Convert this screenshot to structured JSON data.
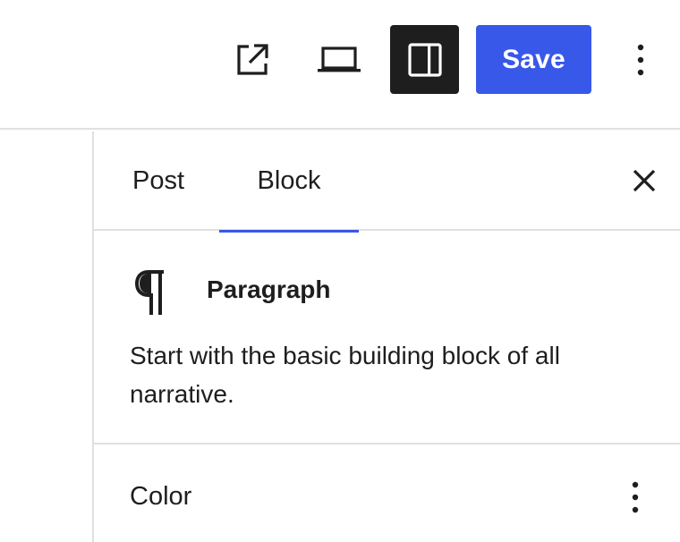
{
  "header": {
    "view_icon": "external-link-icon",
    "preview_icon": "laptop-icon",
    "settings_icon": "sidebar-panel-icon",
    "save_label": "Save",
    "more_icon": "vertical-ellipsis-icon",
    "accent": "#3858e9",
    "active_bg": "#1e1e1e"
  },
  "sidebar": {
    "tabs": [
      {
        "label": "Post",
        "active": false
      },
      {
        "label": "Block",
        "active": true
      }
    ],
    "close_icon": "close-icon",
    "block": {
      "icon": "pilcrow-icon",
      "title": "Paragraph",
      "description": "Start with the basic building block of all narrative."
    },
    "panels": [
      {
        "title": "Color",
        "menu_icon": "vertical-ellipsis-icon"
      }
    ]
  }
}
